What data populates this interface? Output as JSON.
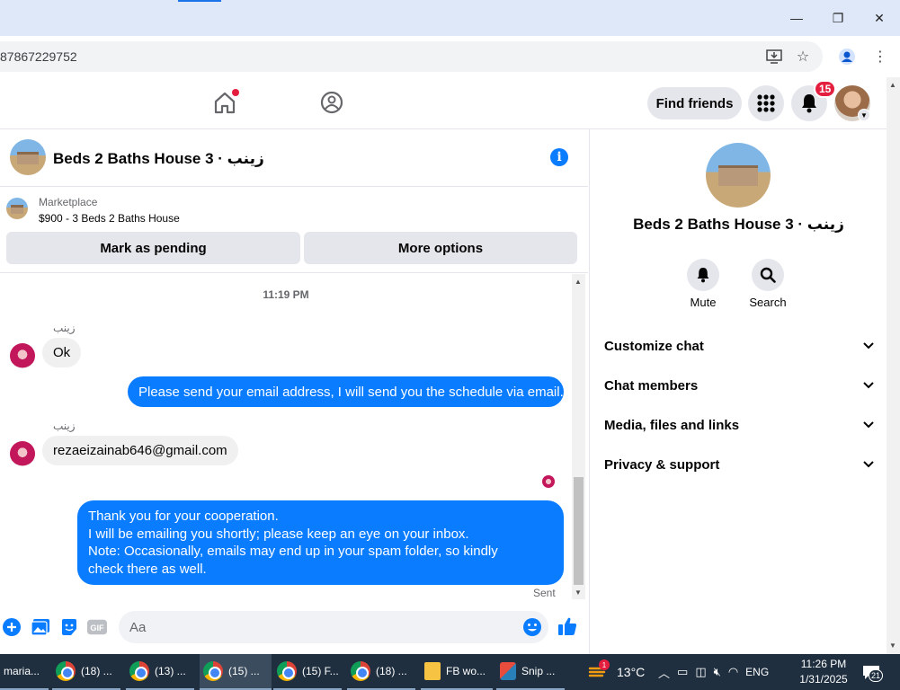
{
  "browser": {
    "url": "87867229752",
    "window_controls": {
      "minimize": "—",
      "restore": "❐",
      "close": "✕"
    }
  },
  "fb_nav": {
    "find_friends": "Find friends",
    "notification_count": "15"
  },
  "chat": {
    "title": "Beds 2 Baths House 3 · زينب",
    "marketplace_label": "Marketplace",
    "marketplace_item": "$900 - 3 Beds 2 Baths House",
    "mark_pending": "Mark as pending",
    "more_options": "More options",
    "timestamp": "11:19 PM",
    "messages": [
      {
        "from": "زينب",
        "text": "Ok",
        "direction": "in"
      },
      {
        "text": "Please send your email address, I will send you the schedule via email.",
        "direction": "out"
      },
      {
        "from": "زينب",
        "text": "rezaeizainab646@gmail.com",
        "direction": "in"
      },
      {
        "lines": [
          "Thank you for your cooperation.",
          "I will be emailing you shortly; please keep an eye on your inbox.",
          "Note: Occasionally, emails may end up in your spam folder, so kindly",
          "check there as well."
        ],
        "direction": "out"
      }
    ],
    "status": "Sent",
    "composer_placeholder": "Aa"
  },
  "right_panel": {
    "name": "Beds 2 Baths House 3 · زينب",
    "actions": [
      {
        "label": "Mute",
        "icon": "bell-icon"
      },
      {
        "label": "Search",
        "icon": "search-icon"
      }
    ],
    "sections": [
      "Customize chat",
      "Chat members",
      "Media, files and links",
      "Privacy & support"
    ]
  },
  "taskbar": {
    "items": [
      "maria...",
      "(18) ...",
      "(13) ...",
      "(15) ...",
      "(15) F...",
      "(18) ...",
      "FB wo...",
      "Snip ..."
    ],
    "weather": "13°C",
    "weather_badge": "1",
    "language": "ENG",
    "time": "11:26 PM",
    "date": "1/31/2025",
    "notification_count": "21"
  },
  "colors": {
    "accent": "#0a7cff",
    "badge": "#e41e3f",
    "bubble_in": "#f0f0f0"
  }
}
